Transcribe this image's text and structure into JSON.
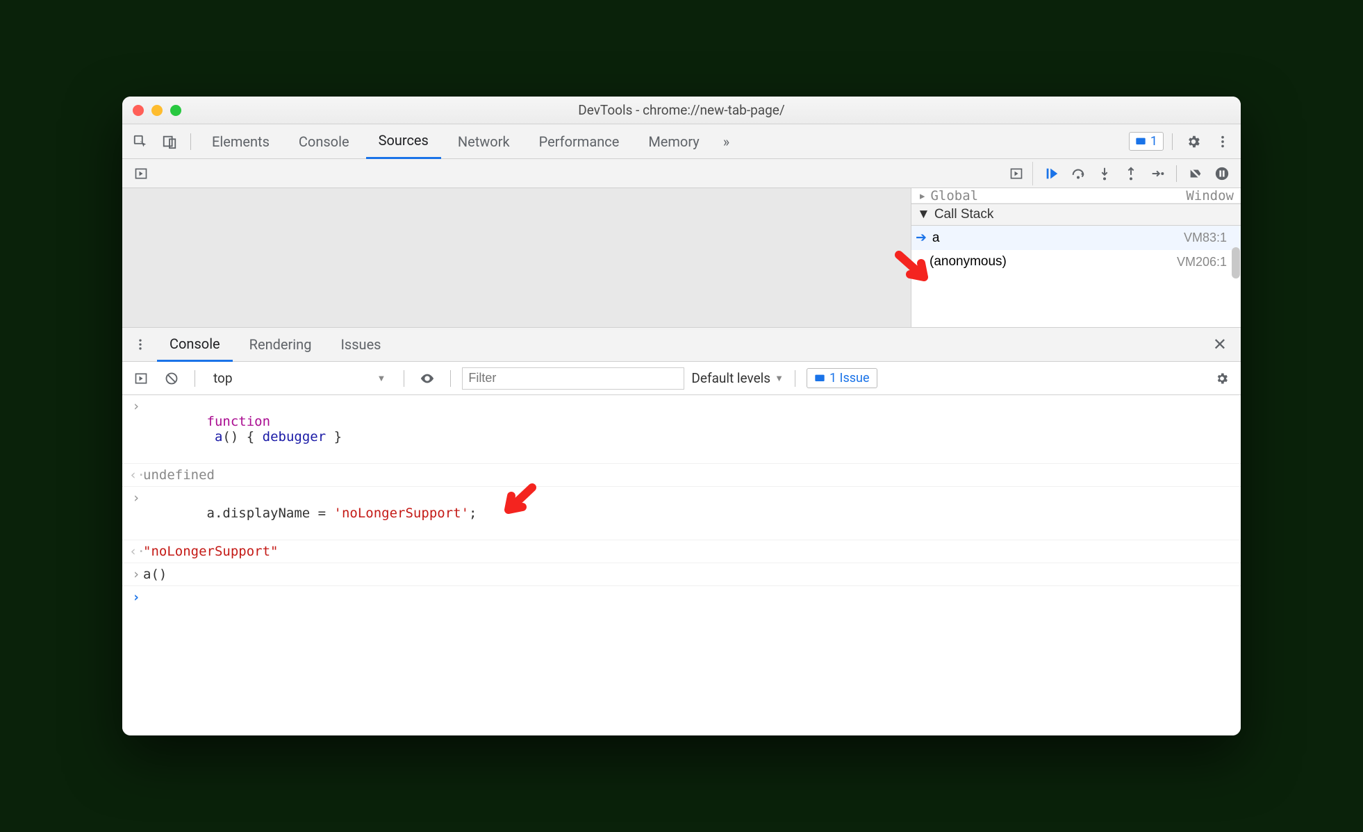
{
  "window": {
    "title": "DevTools - chrome://new-tab-page/"
  },
  "tabs": {
    "items": [
      "Elements",
      "Console",
      "Sources",
      "Network",
      "Performance",
      "Memory"
    ],
    "active": "Sources",
    "more": "»",
    "issue_count": "1"
  },
  "call_stack": {
    "header": "Call Stack",
    "scope_left_partial": "Global",
    "scope_right_partial": "Window",
    "frames": [
      {
        "name": "a",
        "location": "VM83:1",
        "selected": true
      },
      {
        "name": "(anonymous)",
        "location": "VM206:1",
        "selected": false
      }
    ]
  },
  "drawer": {
    "tabs": [
      "Console",
      "Rendering",
      "Issues"
    ],
    "active": "Console"
  },
  "console_toolbar": {
    "context": "top",
    "filter_placeholder": "Filter",
    "levels": "Default levels",
    "issue_pill": "1 Issue"
  },
  "console_lines": {
    "l1_kw": "function",
    "l1_fn": "a",
    "l1_open": "() { ",
    "l1_dbg": "debugger",
    "l1_close": " }",
    "l2": "undefined",
    "l3_prefix": "a.displayName = ",
    "l3_str": "'noLongerSupport'",
    "l3_semi": ";",
    "l4": "\"noLongerSupport\"",
    "l5": "a()"
  }
}
